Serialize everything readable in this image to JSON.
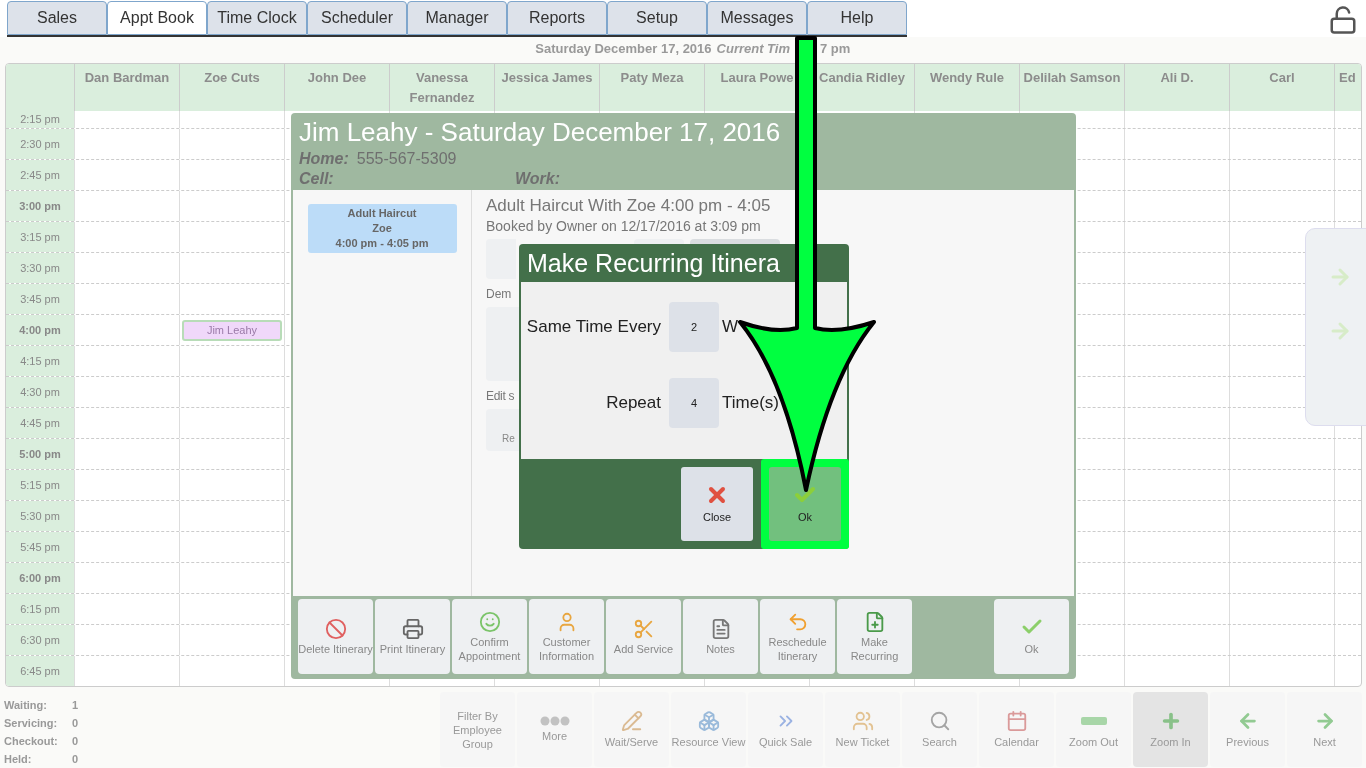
{
  "tabs": [
    {
      "label": "Sales",
      "selected": false
    },
    {
      "label": "Appt Book",
      "selected": true
    },
    {
      "label": "Time Clock",
      "selected": false
    },
    {
      "label": "Scheduler",
      "selected": false
    },
    {
      "label": "Manager",
      "selected": false
    },
    {
      "label": "Reports",
      "selected": false
    },
    {
      "label": "Setup",
      "selected": false
    },
    {
      "label": "Messages",
      "selected": false
    },
    {
      "label": "Help",
      "selected": false
    }
  ],
  "date_line": {
    "date": "Saturday December 17, 2016",
    "current_time_label": "Current Tim",
    "time": "7 pm"
  },
  "schedule": {
    "staff": [
      {
        "name": "Dan Bardman"
      },
      {
        "name": "Zoe Cuts",
        "booking": {
          "label": "Jim Leahy"
        }
      },
      {
        "name": "John Dee"
      },
      {
        "name": "Vanessa Fernandez"
      },
      {
        "name": "Jessica James"
      },
      {
        "name": "Paty Meza"
      },
      {
        "name": "Laura Powe"
      },
      {
        "name": "Candia Ridley"
      },
      {
        "name": "Wendy Rule"
      },
      {
        "name": "Delilah Samson"
      },
      {
        "name": "Ali D."
      },
      {
        "name": "Carl"
      },
      {
        "name": "Ed"
      }
    ],
    "times": [
      {
        "label": "2:15 pm",
        "bold": false,
        "booking_row": false
      },
      {
        "label": "2:30 pm",
        "bold": false,
        "booking_row": false
      },
      {
        "label": "2:45 pm",
        "bold": false,
        "booking_row": false
      },
      {
        "label": "3:00 pm",
        "bold": true,
        "booking_row": false
      },
      {
        "label": "3:15 pm",
        "bold": false,
        "booking_row": false
      },
      {
        "label": "3:30 pm",
        "bold": false,
        "booking_row": false
      },
      {
        "label": "3:45 pm",
        "bold": false,
        "booking_row": false
      },
      {
        "label": "4:00 pm",
        "bold": true,
        "booking_row": true
      },
      {
        "label": "4:15 pm",
        "bold": false,
        "booking_row": false
      },
      {
        "label": "4:30 pm",
        "bold": false,
        "booking_row": false
      },
      {
        "label": "4:45 pm",
        "bold": false,
        "booking_row": false
      },
      {
        "label": "5:00 pm",
        "bold": true,
        "booking_row": false
      },
      {
        "label": "5:15 pm",
        "bold": false,
        "booking_row": false
      },
      {
        "label": "5:30 pm",
        "bold": false,
        "booking_row": false
      },
      {
        "label": "5:45 pm",
        "bold": false,
        "booking_row": false
      },
      {
        "label": "6:00 pm",
        "bold": true,
        "booking_row": false
      },
      {
        "label": "6:15 pm",
        "bold": false,
        "booking_row": false
      },
      {
        "label": "6:30 pm",
        "bold": false,
        "booking_row": false
      },
      {
        "label": "6:45 pm",
        "bold": false,
        "booking_row": false
      }
    ]
  },
  "itinerary": {
    "title": "Jim Leahy - Saturday December 17, 2016",
    "home_label": "Home:",
    "home_value": "555-567-5309",
    "cell_label": "Cell:",
    "work_label": "Work:",
    "service_card": {
      "name": "Adult Haircut",
      "staff": "Zoe",
      "time": "4:00 pm - 4:05 pm"
    },
    "service_title": "Adult Haircut With Zoe 4:00 pm - 4:05",
    "booked_by": "Booked by Owner on 12/17/2016 at 3:09 pm",
    "section_1": "Dem",
    "section_2": "Edit s",
    "section_2_button": "Re",
    "toolbar": [
      {
        "label": "Delete Itinerary",
        "kind": "delete"
      },
      {
        "label": "Print Itinerary",
        "kind": "print"
      },
      {
        "label": "Confirm Appointment",
        "kind": "confirm"
      },
      {
        "label": "Customer Information",
        "kind": "customer"
      },
      {
        "label": "Add Service",
        "kind": "scissors"
      },
      {
        "label": "Notes",
        "kind": "notes"
      },
      {
        "label": "Reschedule Itinerary",
        "kind": "reschedule"
      },
      {
        "label": "Make Recurring",
        "kind": "recurring"
      }
    ],
    "ok_button": {
      "label": "Ok"
    }
  },
  "dialog": {
    "title": "Make Recurring Itinera",
    "fields": [
      {
        "label": "Same Time Every",
        "value": "2",
        "unit": "W"
      },
      {
        "label": "Repeat",
        "value": "4",
        "unit": "Time(s)"
      }
    ],
    "buttons": [
      {
        "label": "Close",
        "kind": "close",
        "highlighted": false
      },
      {
        "label": "Ok",
        "kind": "ok",
        "highlighted": true
      }
    ]
  },
  "counters": [
    {
      "label": "Waiting:",
      "value": "1"
    },
    {
      "label": "Servicing:",
      "value": "0"
    },
    {
      "label": "Checkout:",
      "value": "0"
    },
    {
      "label": "Held:",
      "value": "0"
    }
  ],
  "bottom_toolbar": [
    {
      "label": "Filter By Employee Group",
      "kind": "text",
      "selected": false
    },
    {
      "label": "More",
      "kind": "more",
      "selected": false
    },
    {
      "label": "Wait/Serve",
      "kind": "wait",
      "selected": false
    },
    {
      "label": "Resource View",
      "kind": "resource",
      "selected": false
    },
    {
      "label": "Quick Sale",
      "kind": "quick",
      "selected": false
    },
    {
      "label": "New Ticket",
      "kind": "ticket",
      "selected": false
    },
    {
      "label": "Search",
      "kind": "search",
      "selected": false
    },
    {
      "label": "Calendar",
      "kind": "calendar",
      "selected": false
    },
    {
      "label": "Zoom Out",
      "kind": "zoomout",
      "selected": false
    },
    {
      "label": "Zoom In",
      "kind": "zoomin",
      "selected": true
    },
    {
      "label": "Previous",
      "kind": "previous",
      "selected": false
    },
    {
      "label": "Next",
      "kind": "next",
      "selected": false
    }
  ]
}
